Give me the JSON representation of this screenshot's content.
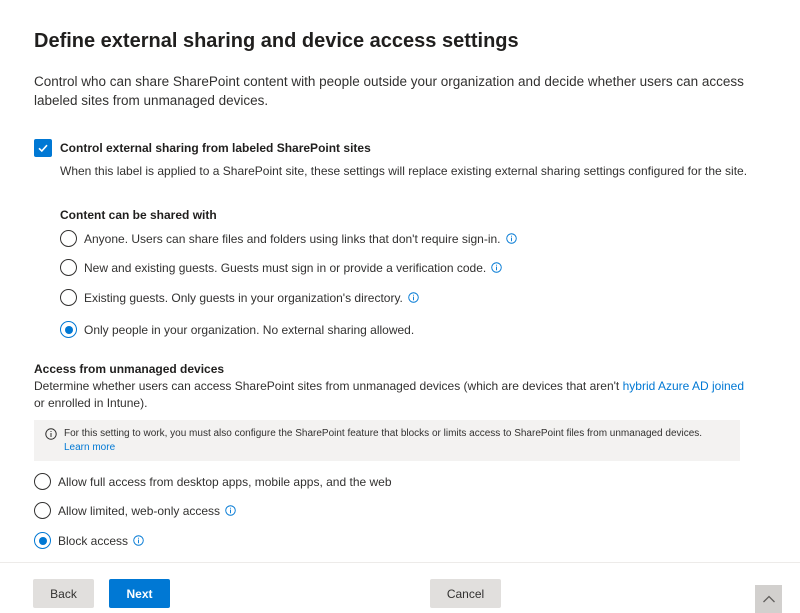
{
  "page": {
    "title": "Define external sharing and device access settings",
    "intro": "Control who can share SharePoint content with people outside your organization and decide whether users can access labeled sites from unmanaged devices."
  },
  "external_sharing": {
    "checkbox_label": "Control external sharing from labeled SharePoint sites",
    "checked": true,
    "description": "When this label is applied to a SharePoint site, these settings will replace existing external sharing settings configured for the site.",
    "shared_with_heading": "Content can be shared with",
    "options": [
      {
        "label": "Anyone. Users can share files and folders using links that don't require sign-in.",
        "selected": false,
        "info_icon": true
      },
      {
        "label": "New and existing guests. Guests must sign in or provide a verification code.",
        "selected": false,
        "info_icon": true
      },
      {
        "label": "Existing guests. Only guests in your organization's directory.",
        "selected": false,
        "info_icon": true
      },
      {
        "label": "Only people in your organization. No external sharing allowed.",
        "selected": true,
        "info_icon": false
      }
    ]
  },
  "unmanaged_devices": {
    "heading": "Access from unmanaged devices",
    "desc_before": "Determine whether users can access SharePoint sites from unmanaged devices (which are devices that aren't ",
    "desc_link": "hybrid Azure AD joined",
    "desc_after": " or enrolled in Intune).",
    "info_text": "For this setting to work, you must also configure the SharePoint feature that blocks or limits access to SharePoint files from unmanaged devices.",
    "info_link": "Learn more",
    "options": [
      {
        "label": "Allow full access from desktop apps, mobile apps, and the web",
        "selected": false,
        "info_icon": false
      },
      {
        "label": "Allow limited, web-only access",
        "selected": false,
        "info_icon": true
      },
      {
        "label": "Block access",
        "selected": true,
        "info_icon": true
      }
    ]
  },
  "footer": {
    "back_label": "Back",
    "next_label": "Next",
    "cancel_label": "Cancel"
  },
  "icons": {
    "info": "info-icon",
    "checkmark": "checkmark-icon",
    "scroll_up": "chevron-up-icon"
  },
  "colors": {
    "accent": "#0078d4",
    "info_box_bg": "#f3f2f1",
    "button_default_bg": "#e1dfdd"
  }
}
